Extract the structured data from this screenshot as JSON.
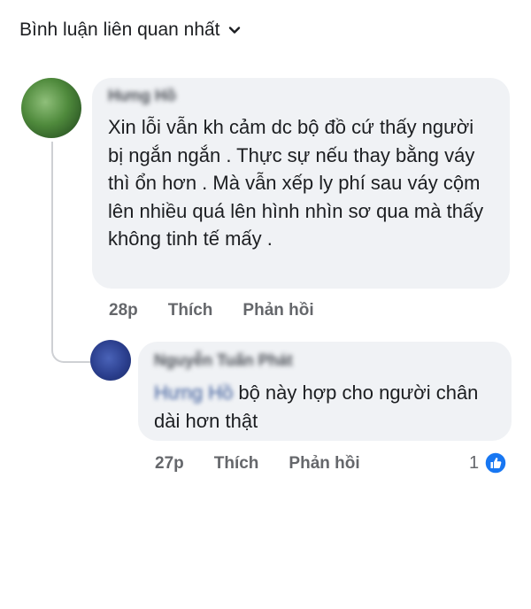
{
  "header": {
    "title": "Bình luận liên quan nhất"
  },
  "comments": [
    {
      "author": "Hưng Hồ",
      "text": "Xin lỗi vẫn kh cảm dc bộ đồ cứ thấy người bị ngắn ngắn . Thực sự nếu thay bằng váy thì ổn hơn . Mà vẫn xếp ly phí sau váy cộm lên nhiều quá lên hình nhìn sơ qua mà thấy không tinh tế mấy .",
      "time": "28p",
      "like_label": "Thích",
      "reply_label": "Phản hồi"
    },
    {
      "author": "Nguyễn Tuấn Phát",
      "mention": "Hưng Hồ",
      "text": "bộ này hợp cho người chân dài hơn thật",
      "time": "27p",
      "like_label": "Thích",
      "reply_label": "Phản hồi",
      "reaction_count": "1"
    }
  ],
  "colors": {
    "bubble": "#f0f2f5",
    "meta": "#65676b",
    "like_blue": "#1877f2"
  }
}
